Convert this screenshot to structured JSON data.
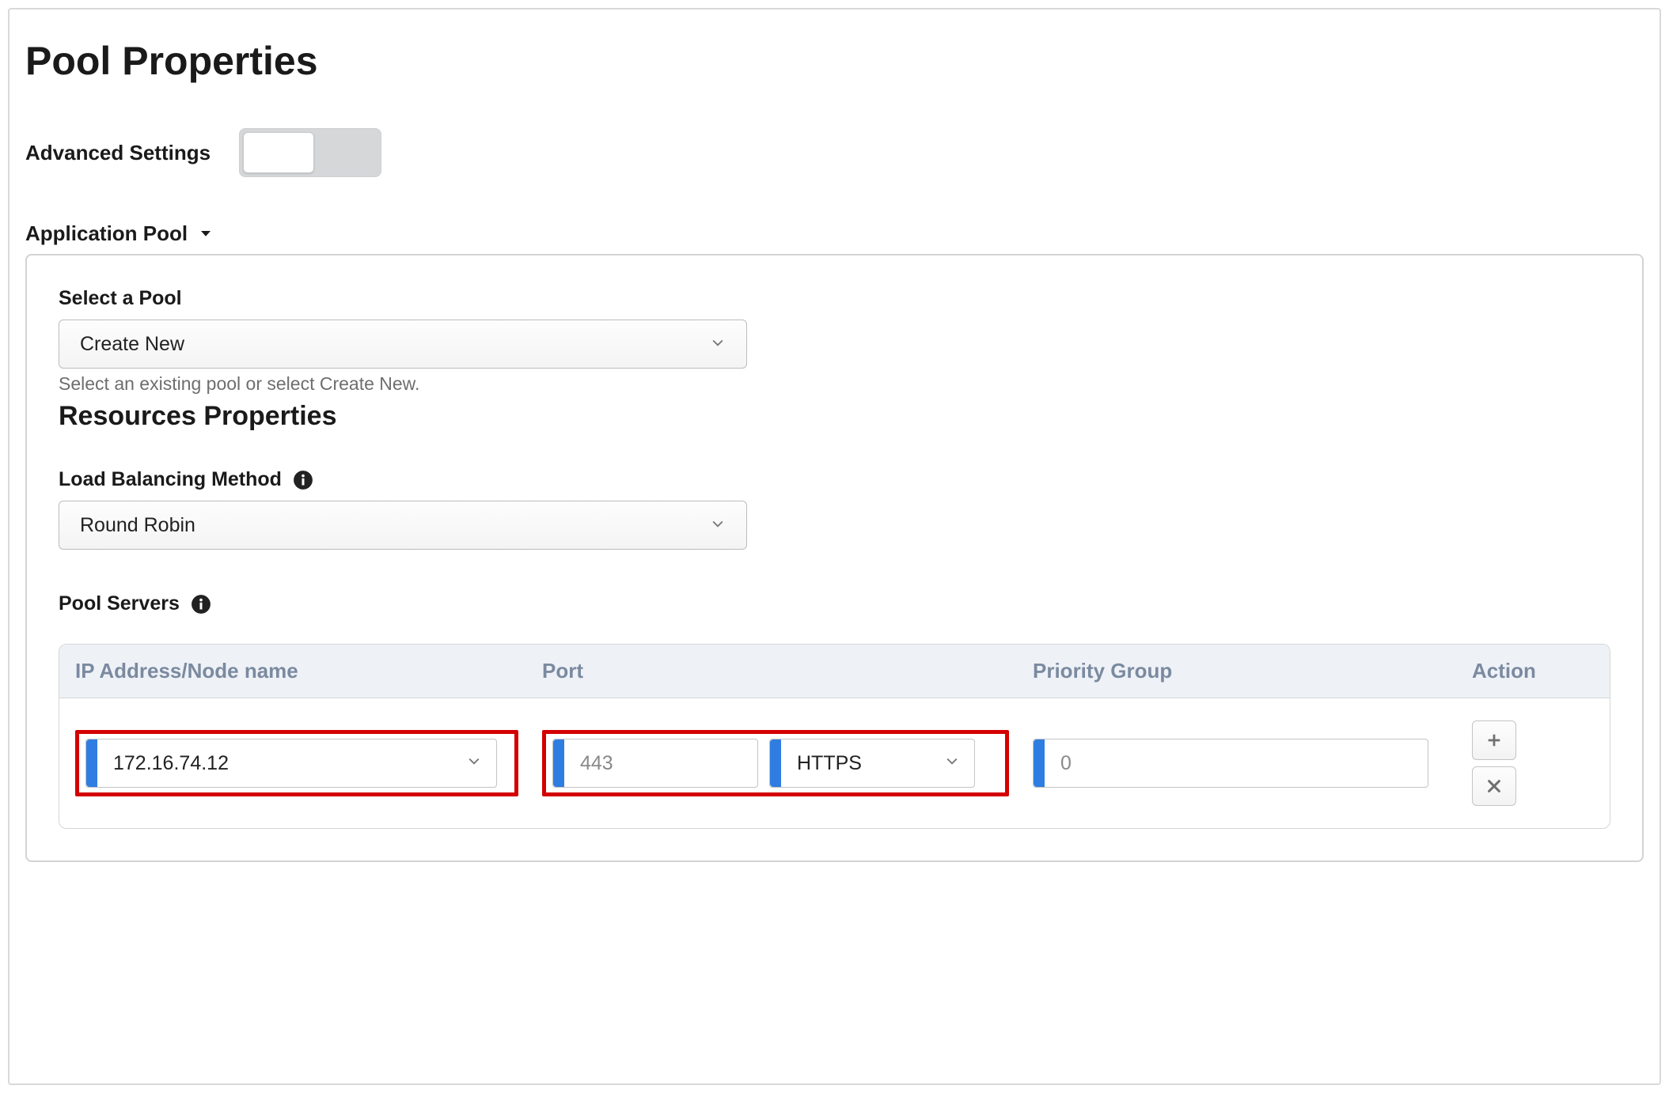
{
  "page_title": "Pool Properties",
  "advanced_settings_label": "Advanced Settings",
  "advanced_settings_on": false,
  "section": {
    "title": "Application Pool",
    "expanded": true
  },
  "select_pool": {
    "label": "Select a Pool",
    "value": "Create New",
    "helper": "Select an existing pool or select Create New."
  },
  "resources_title": "Resources Properties",
  "load_balancing": {
    "label": "Load Balancing Method",
    "value": "Round Robin"
  },
  "pool_servers": {
    "label": "Pool Servers",
    "columns": {
      "ip": "IP Address/Node name",
      "port": "Port",
      "priority": "Priority Group",
      "action": "Action"
    },
    "rows": [
      {
        "ip": "172.16.74.12",
        "port": "443",
        "protocol": "HTTPS",
        "priority": "0"
      }
    ]
  }
}
